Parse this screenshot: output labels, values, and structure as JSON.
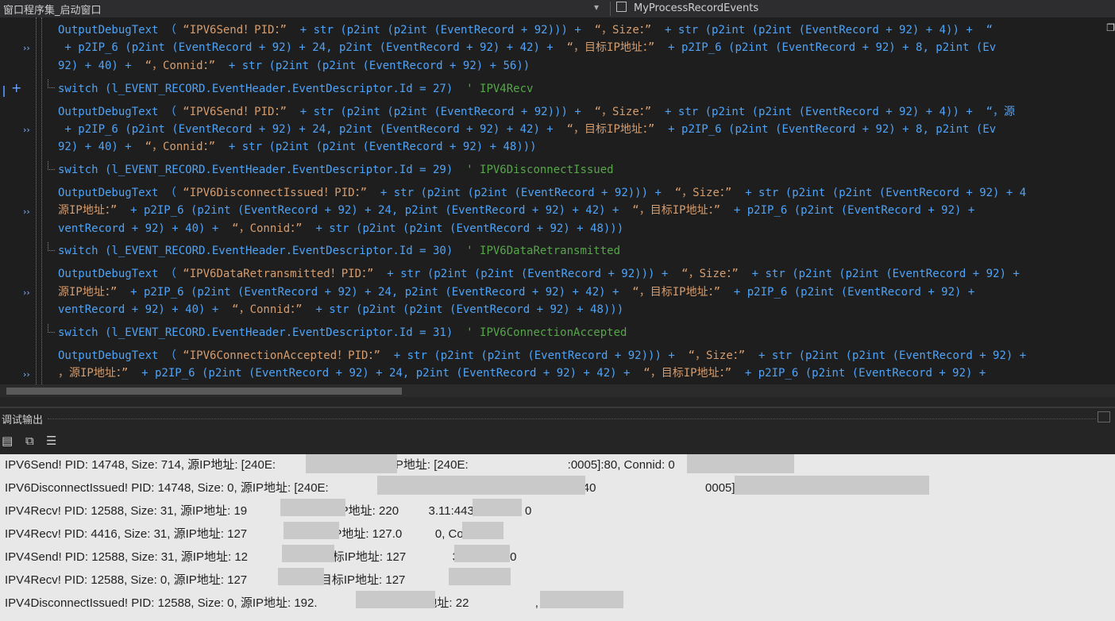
{
  "titlebar": {
    "left_label": "窗口程序集_启动窗口",
    "right_label": "MyProcessRecordEvents",
    "right_icon": "cube-icon",
    "dropdown_icon": "chevron-down-icon"
  },
  "code": {
    "lines": [
      {
        "parts": [
          {
            "t": "OutputDebugText （ ",
            "c": "c-id"
          },
          {
            "t": "“IPV6Send！PID：” ",
            "c": "c-str"
          },
          {
            "t": " + str (p2int (p2int (EventRecord + 92))) + ",
            "c": "c-id"
          },
          {
            "t": " “，Size：” ",
            "c": "c-str"
          },
          {
            "t": " + str (p2int (p2int (EventRecord + 92) + 4)) +  “",
            "c": "c-id"
          }
        ]
      },
      {
        "parts": [
          {
            "t": " + p2IP_6 (p2int (EventRecord + 92) + 24, p2int (EventRecord + 92) + 42) + ",
            "c": "c-id"
          },
          {
            "t": " “，目标IP地址：” ",
            "c": "c-str"
          },
          {
            "t": " + p2IP_6 (p2int (EventRecord + 92) + 8, p2int (Ev",
            "c": "c-id"
          }
        ]
      },
      {
        "parts": [
          {
            "t": "92) + 40) + ",
            "c": "c-id"
          },
          {
            "t": " “，Connid：” ",
            "c": "c-str"
          },
          {
            "t": " + str (p2int (p2int (EventRecord + 92) + 56))",
            "c": "c-id"
          }
        ]
      },
      {
        "parts": [
          {
            "t": "switch (l_EVENT_RECORD.EventHeader.EventDescriptor.Id = 27)  ",
            "c": "c-id"
          },
          {
            "t": "' IPV4Recv",
            "c": "c-cmt"
          }
        ]
      },
      {
        "parts": [
          {
            "t": "OutputDebugText （ ",
            "c": "c-id"
          },
          {
            "t": "“IPV6Send！PID：” ",
            "c": "c-str"
          },
          {
            "t": " + str (p2int (p2int (EventRecord + 92))) + ",
            "c": "c-id"
          },
          {
            "t": " “，Size：” ",
            "c": "c-str"
          },
          {
            "t": " + str (p2int (p2int (EventRecord + 92) + 4)) +  “，源",
            "c": "c-id"
          }
        ]
      },
      {
        "parts": [
          {
            "t": " + p2IP_6 (p2int (EventRecord + 92) + 24, p2int (EventRecord + 92) + 42) + ",
            "c": "c-id"
          },
          {
            "t": " “，目标IP地址：” ",
            "c": "c-str"
          },
          {
            "t": " + p2IP_6 (p2int (EventRecord + 92) + 8, p2int (Ev",
            "c": "c-id"
          }
        ]
      },
      {
        "parts": [
          {
            "t": "92) + 40) + ",
            "c": "c-id"
          },
          {
            "t": " “，Connid：” ",
            "c": "c-str"
          },
          {
            "t": " + str (p2int (p2int (EventRecord + 92) + 48)))",
            "c": "c-id"
          }
        ]
      },
      {
        "parts": [
          {
            "t": "switch (l_EVENT_RECORD.EventHeader.EventDescriptor.Id = 29)  ",
            "c": "c-id"
          },
          {
            "t": "' IPV6DisconnectIssued",
            "c": "c-cmt"
          }
        ]
      },
      {
        "parts": [
          {
            "t": "OutputDebugText （ ",
            "c": "c-id"
          },
          {
            "t": "“IPV6DisconnectIssued！PID：” ",
            "c": "c-str"
          },
          {
            "t": " + str (p2int (p2int (EventRecord + 92))) + ",
            "c": "c-id"
          },
          {
            "t": " “，Size：” ",
            "c": "c-str"
          },
          {
            "t": " + str (p2int (p2int (EventRecord + 92) + 4",
            "c": "c-id"
          }
        ]
      },
      {
        "parts": [
          {
            "t": "源IP地址：” ",
            "c": "c-str"
          },
          {
            "t": " + p2IP_6 (p2int (EventRecord + 92) + 24, p2int (EventRecord + 92) + 42) + ",
            "c": "c-id"
          },
          {
            "t": " “，目标IP地址：” ",
            "c": "c-str"
          },
          {
            "t": " + p2IP_6 (p2int (EventRecord + 92) + ",
            "c": "c-id"
          }
        ]
      },
      {
        "parts": [
          {
            "t": "ventRecord + 92) + 40) + ",
            "c": "c-id"
          },
          {
            "t": " “，Connid：” ",
            "c": "c-str"
          },
          {
            "t": " + str (p2int (p2int (EventRecord + 92) + 48)))",
            "c": "c-id"
          }
        ]
      },
      {
        "parts": [
          {
            "t": "switch (l_EVENT_RECORD.EventHeader.EventDescriptor.Id = 30)  ",
            "c": "c-id"
          },
          {
            "t": "' IPV6DataRetransmitted",
            "c": "c-cmt"
          }
        ]
      },
      {
        "parts": [
          {
            "t": "OutputDebugText （ ",
            "c": "c-id"
          },
          {
            "t": "“IPV6DataRetransmitted！PID：” ",
            "c": "c-str"
          },
          {
            "t": " + str (p2int (p2int (EventRecord + 92))) + ",
            "c": "c-id"
          },
          {
            "t": " “，Size：” ",
            "c": "c-str"
          },
          {
            "t": " + str (p2int (p2int (EventRecord + 92) + ",
            "c": "c-id"
          }
        ]
      },
      {
        "parts": [
          {
            "t": "源IP地址：” ",
            "c": "c-str"
          },
          {
            "t": " + p2IP_6 (p2int (EventRecord + 92) + 24, p2int (EventRecord + 92) + 42) + ",
            "c": "c-id"
          },
          {
            "t": " “，目标IP地址：” ",
            "c": "c-str"
          },
          {
            "t": " + p2IP_6 (p2int (EventRecord + 92) + ",
            "c": "c-id"
          }
        ]
      },
      {
        "parts": [
          {
            "t": "ventRecord + 92) + 40) + ",
            "c": "c-id"
          },
          {
            "t": " “，Connid：” ",
            "c": "c-str"
          },
          {
            "t": " + str (p2int (p2int (EventRecord + 92) + 48)))",
            "c": "c-id"
          }
        ]
      },
      {
        "parts": [
          {
            "t": "switch (l_EVENT_RECORD.EventHeader.EventDescriptor.Id = 31)  ",
            "c": "c-id"
          },
          {
            "t": "' IPV6ConnectionAccepted",
            "c": "c-cmt"
          }
        ]
      },
      {
        "parts": [
          {
            "t": "OutputDebugText （ ",
            "c": "c-id"
          },
          {
            "t": "“IPV6ConnectionAccepted！PID：” ",
            "c": "c-str"
          },
          {
            "t": " + str (p2int (p2int (EventRecord + 92))) + ",
            "c": "c-id"
          },
          {
            "t": " “，Size：” ",
            "c": "c-str"
          },
          {
            "t": " + str (p2int (p2int (EventRecord + 92) +",
            "c": "c-id"
          }
        ]
      },
      {
        "parts": [
          {
            "t": "，源IP地址：” ",
            "c": "c-str"
          },
          {
            "t": " + p2IP_6 (p2int (EventRecord + 92) + 24, p2int (EventRecord + 92) + 42) + ",
            "c": "c-id"
          },
          {
            "t": " “，目标IP地址：” ",
            "c": "c-str"
          },
          {
            "t": " + p2IP_6 (p2int (EventRecord + 92) +",
            "c": "c-id"
          }
        ]
      }
    ]
  },
  "output_panel": {
    "title": "调试输出",
    "toolbar_icons": [
      "clear-icon",
      "copy-icon",
      "wrap-icon"
    ],
    "lines": [
      "IPV6Send! PID: 14748, Size: 714, 源IP地址: [240E:                58639, 目标IP地址: [240E:                              :0005]:80, Connid: 0",
      "IPV6DisconnectIssued! PID: 14748, Size: 0, 源IP地址: [240E:                                        ]:58639, 目标IP地址: [240                                 0005]:80, Connid: 0",
      "IPV4Recv! PID: 12588, Size: 31, 源IP地址: 19              34, 目标IP地址: 220         3.11:443, Connid: 0",
      "IPV4Recv! PID: 4416, Size: 31, 源IP地址: 127              3, 目标IP地址: 127.0          0, Connid: 0",
      "IPV4Send! PID: 12588, Size: 31, 源IP地址: 12              890, 目标IP地址: 127              3, Connid: 0",
      "IPV4Recv! PID: 12588, Size: 0, 源IP地址: 127              890, 目标IP地址: 127             , Connid: 0",
      "IPV4DisconnectIssued! PID: 12588, Size: 0, 源IP地址: 192.                    , 目标IP地址: 22                    , Connid: 0"
    ]
  }
}
